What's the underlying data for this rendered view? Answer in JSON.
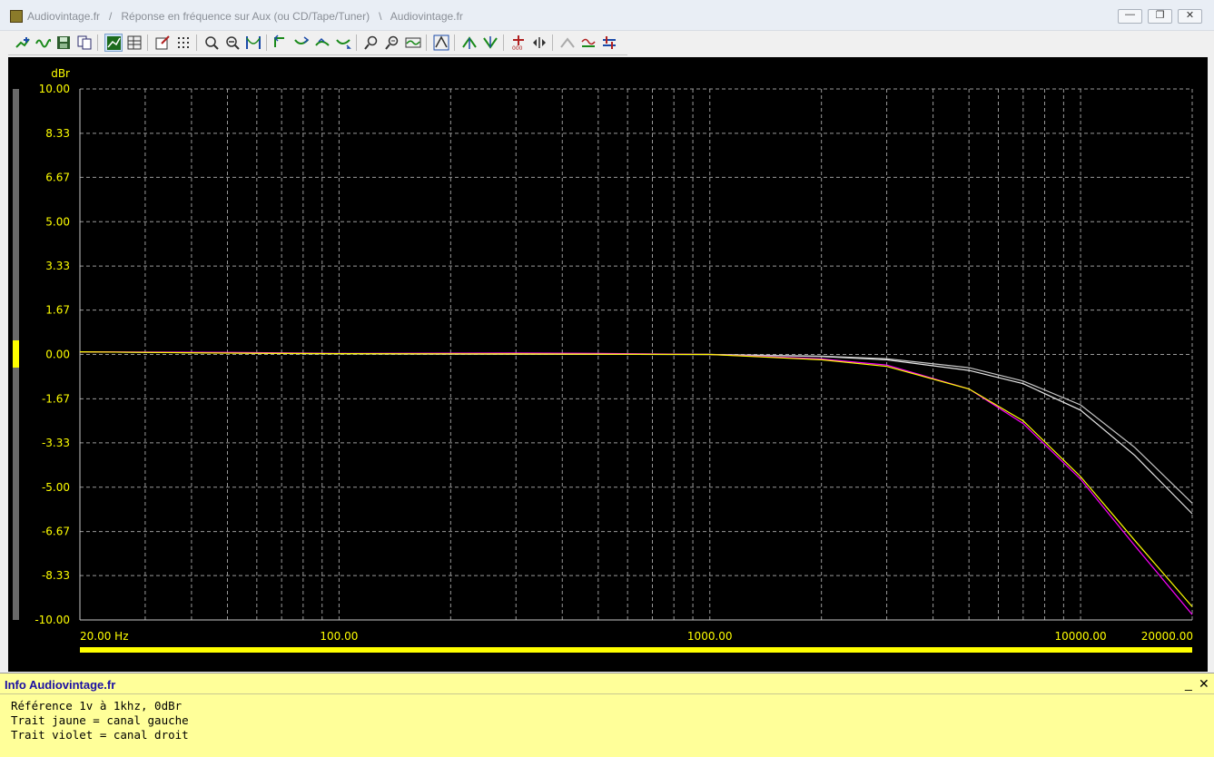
{
  "window": {
    "title": "Audiovintage.fr   /   Réponse en fréquence sur Aux (ou CD/Tape/Tuner)   \\   Audiovintage.fr",
    "minimize_label": "—",
    "restore_label": "❐",
    "close_label": "✕"
  },
  "toolbar": {
    "icons": [
      "cursor-plus-icon",
      "sine-icon",
      "save-icon",
      "copy-icon",
      "graph-grid-icon",
      "table-icon",
      "edit-icon",
      "dots-grid-icon",
      "zoom-box-icon",
      "zoom-out-icon",
      "curve-icon",
      "rotate-left-icon",
      "rotate-right-icon",
      "shift-up-icon",
      "shift-down-icon",
      "zoom-x-icon",
      "zoom-y-icon",
      "fit-curve-icon",
      "scale-icon",
      "peak-up-icon",
      "peak-down-icon",
      "marker-add-icon",
      "marker-move-icon",
      "marker-off-icon",
      "sweep-icon",
      "settings-arrows-icon"
    ]
  },
  "chart_data": {
    "type": "line",
    "ylabel": "dBr",
    "xscale": "log",
    "xlim": [
      20,
      20000
    ],
    "ylim": [
      -10,
      10
    ],
    "grid": true,
    "yticks": [
      "10.00",
      "8.33",
      "6.67",
      "5.00",
      "3.33",
      "1.67",
      "0.00",
      "-1.67",
      "-3.33",
      "-5.00",
      "-6.67",
      "-8.33",
      "-10.00"
    ],
    "xtick_labels": [
      {
        "x": 20,
        "label": "20.00 Hz"
      },
      {
        "x": 100,
        "label": "100.00"
      },
      {
        "x": 1000,
        "label": "1000.00"
      },
      {
        "x": 10000,
        "label": "10000.00"
      },
      {
        "x": 20000,
        "label": "20000.00"
      }
    ],
    "series": [
      {
        "color": "#ffff00",
        "x": [
          20,
          50,
          100,
          300,
          1000,
          2000,
          3000,
          5000,
          7000,
          10000,
          14000,
          20000
        ],
        "y": [
          0.1,
          0.05,
          0.03,
          0.02,
          0,
          -0.2,
          -0.45,
          -1.3,
          -2.5,
          -4.6,
          -7.0,
          -9.5
        ]
      },
      {
        "color": "#ff00ff",
        "x": [
          20,
          50,
          100,
          300,
          500,
          1000,
          2000,
          3000,
          5000,
          7000,
          10000,
          14000,
          20000
        ],
        "y": [
          0.1,
          0.08,
          0.04,
          0.05,
          0.04,
          0,
          -0.17,
          -0.4,
          -1.3,
          -2.6,
          -4.7,
          -7.2,
          -9.8
        ]
      },
      {
        "color": "#e8e8e8",
        "x": [
          20,
          100,
          1000,
          2000,
          3000,
          5000,
          7000,
          10000,
          14000,
          20000
        ],
        "y": [
          0.1,
          0.02,
          0,
          -0.08,
          -0.2,
          -0.6,
          -1.1,
          -2.1,
          -3.8,
          -6.0
        ]
      },
      {
        "color": "#c8c8c8",
        "x": [
          20,
          100,
          1000,
          2000,
          3000,
          5000,
          7000,
          10000,
          14000,
          20000
        ],
        "y": [
          0.1,
          0.02,
          0,
          -0.06,
          -0.16,
          -0.5,
          -1.0,
          -1.9,
          -3.5,
          -5.6
        ]
      }
    ]
  },
  "info": {
    "title": "Info Audiovintage.fr",
    "lines": [
      "Référence 1v à 1khz, 0dBr",
      "Trait jaune = canal gauche",
      "Trait violet = canal droit"
    ],
    "minimize_label": "_",
    "close_label": "✕"
  },
  "colors": {
    "axis_text": "#ffff00",
    "grid": "#9a9a9a",
    "plot_bg": "#000000",
    "info_bg": "#ffff99",
    "info_title": "#1a0ea3"
  }
}
